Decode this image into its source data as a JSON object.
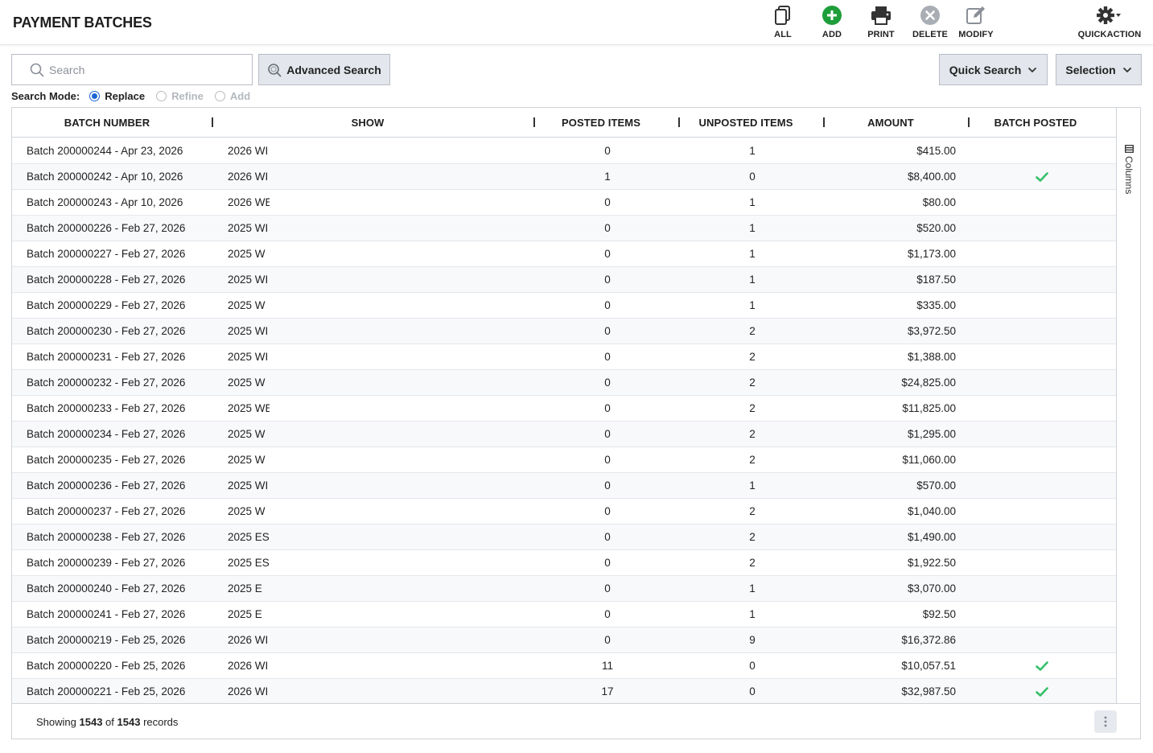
{
  "header": {
    "title": "PAYMENT BATCHES",
    "actions": [
      {
        "label": "ALL",
        "icon": "copy-icon"
      },
      {
        "label": "ADD",
        "icon": "add-circle-icon"
      },
      {
        "label": "PRINT",
        "icon": "printer-icon"
      },
      {
        "label": "DELETE",
        "icon": "delete-circle-icon"
      },
      {
        "label": "MODIFY",
        "icon": "edit-icon"
      },
      {
        "label": "QUICKACTION",
        "icon": "gear-icon"
      }
    ]
  },
  "search": {
    "placeholder": "Search",
    "value": "",
    "advanced_label": "Advanced Search",
    "quick_search_label": "Quick Search",
    "selection_label": "Selection",
    "mode_label": "Search Mode:",
    "modes": [
      "Replace",
      "Refine",
      "Add"
    ],
    "selected_mode": "Replace"
  },
  "grid": {
    "columns": [
      "BATCH NUMBER",
      "SHOW",
      "POSTED ITEMS",
      "UNPOSTED ITEMS",
      "AMOUNT",
      "BATCH POSTED"
    ],
    "columns_tab_label": "Columns",
    "rows": [
      {
        "batch": "Batch 200000244 - Apr 23, 2026",
        "show": "2026 WI",
        "posted": "0",
        "unposted": "1",
        "amount": "$415.00",
        "batch_posted": false
      },
      {
        "batch": "Batch 200000242 - Apr 10, 2026",
        "show": "2026 WI",
        "posted": "1",
        "unposted": "0",
        "amount": "$8,400.00",
        "batch_posted": true
      },
      {
        "batch": "Batch 200000243 - Apr 10, 2026",
        "show": "2026 WE",
        "posted": "0",
        "unposted": "1",
        "amount": "$80.00",
        "batch_posted": false
      },
      {
        "batch": "Batch 200000226 - Feb 27, 2026",
        "show": "2025 WI",
        "posted": "0",
        "unposted": "1",
        "amount": "$520.00",
        "batch_posted": false
      },
      {
        "batch": "Batch 200000227 - Feb 27, 2026",
        "show": "2025 W",
        "posted": "0",
        "unposted": "1",
        "amount": "$1,173.00",
        "batch_posted": false
      },
      {
        "batch": "Batch 200000228 - Feb 27, 2026",
        "show": "2025 WI",
        "posted": "0",
        "unposted": "1",
        "amount": "$187.50",
        "batch_posted": false
      },
      {
        "batch": "Batch 200000229 - Feb 27, 2026",
        "show": "2025 W",
        "posted": "0",
        "unposted": "1",
        "amount": "$335.00",
        "batch_posted": false
      },
      {
        "batch": "Batch 200000230 - Feb 27, 2026",
        "show": "2025 WI",
        "posted": "0",
        "unposted": "2",
        "amount": "$3,972.50",
        "batch_posted": false
      },
      {
        "batch": "Batch 200000231 - Feb 27, 2026",
        "show": "2025 WI",
        "posted": "0",
        "unposted": "2",
        "amount": "$1,388.00",
        "batch_posted": false
      },
      {
        "batch": "Batch 200000232 - Feb 27, 2026",
        "show": "2025 W",
        "posted": "0",
        "unposted": "2",
        "amount": "$24,825.00",
        "batch_posted": false
      },
      {
        "batch": "Batch 200000233 - Feb 27, 2026",
        "show": "2025 WE",
        "posted": "0",
        "unposted": "2",
        "amount": "$11,825.00",
        "batch_posted": false
      },
      {
        "batch": "Batch 200000234 - Feb 27, 2026",
        "show": "2025 W",
        "posted": "0",
        "unposted": "2",
        "amount": "$1,295.00",
        "batch_posted": false
      },
      {
        "batch": "Batch 200000235 - Feb 27, 2026",
        "show": "2025 W",
        "posted": "0",
        "unposted": "2",
        "amount": "$11,060.00",
        "batch_posted": false
      },
      {
        "batch": "Batch 200000236 - Feb 27, 2026",
        "show": "2025 WI",
        "posted": "0",
        "unposted": "1",
        "amount": "$570.00",
        "batch_posted": false
      },
      {
        "batch": "Batch 200000237 - Feb 27, 2026",
        "show": "2025 W",
        "posted": "0",
        "unposted": "2",
        "amount": "$1,040.00",
        "batch_posted": false
      },
      {
        "batch": "Batch 200000238 - Feb 27, 2026",
        "show": "2025 ES",
        "posted": "0",
        "unposted": "2",
        "amount": "$1,490.00",
        "batch_posted": false
      },
      {
        "batch": "Batch 200000239 - Feb 27, 2026",
        "show": "2025 ES",
        "posted": "0",
        "unposted": "2",
        "amount": "$1,922.50",
        "batch_posted": false
      },
      {
        "batch": "Batch 200000240 - Feb 27, 2026",
        "show": "2025 E",
        "posted": "0",
        "unposted": "1",
        "amount": "$3,070.00",
        "batch_posted": false
      },
      {
        "batch": "Batch 200000241 - Feb 27, 2026",
        "show": "2025 E",
        "posted": "0",
        "unposted": "1",
        "amount": "$92.50",
        "batch_posted": false
      },
      {
        "batch": "Batch 200000219 - Feb 25, 2026",
        "show": "2026 WI",
        "posted": "0",
        "unposted": "9",
        "amount": "$16,372.86",
        "batch_posted": false
      },
      {
        "batch": "Batch 200000220 - Feb 25, 2026",
        "show": "2026 WI",
        "posted": "11",
        "unposted": "0",
        "amount": "$10,057.51",
        "batch_posted": true
      },
      {
        "batch": "Batch 200000221 - Feb 25, 2026",
        "show": "2026 WI",
        "posted": "17",
        "unposted": "0",
        "amount": "$32,987.50",
        "batch_posted": true
      }
    ]
  },
  "footer": {
    "showing_label": "Showing",
    "shown_count": "1543",
    "of_label": "of",
    "total_count": "1543",
    "records_label": "records"
  },
  "colors": {
    "add_green": "#1e9e3a",
    "check_green": "#35c06a",
    "radio_blue": "#1a64d6",
    "button_gray": "#e3e6ec"
  }
}
